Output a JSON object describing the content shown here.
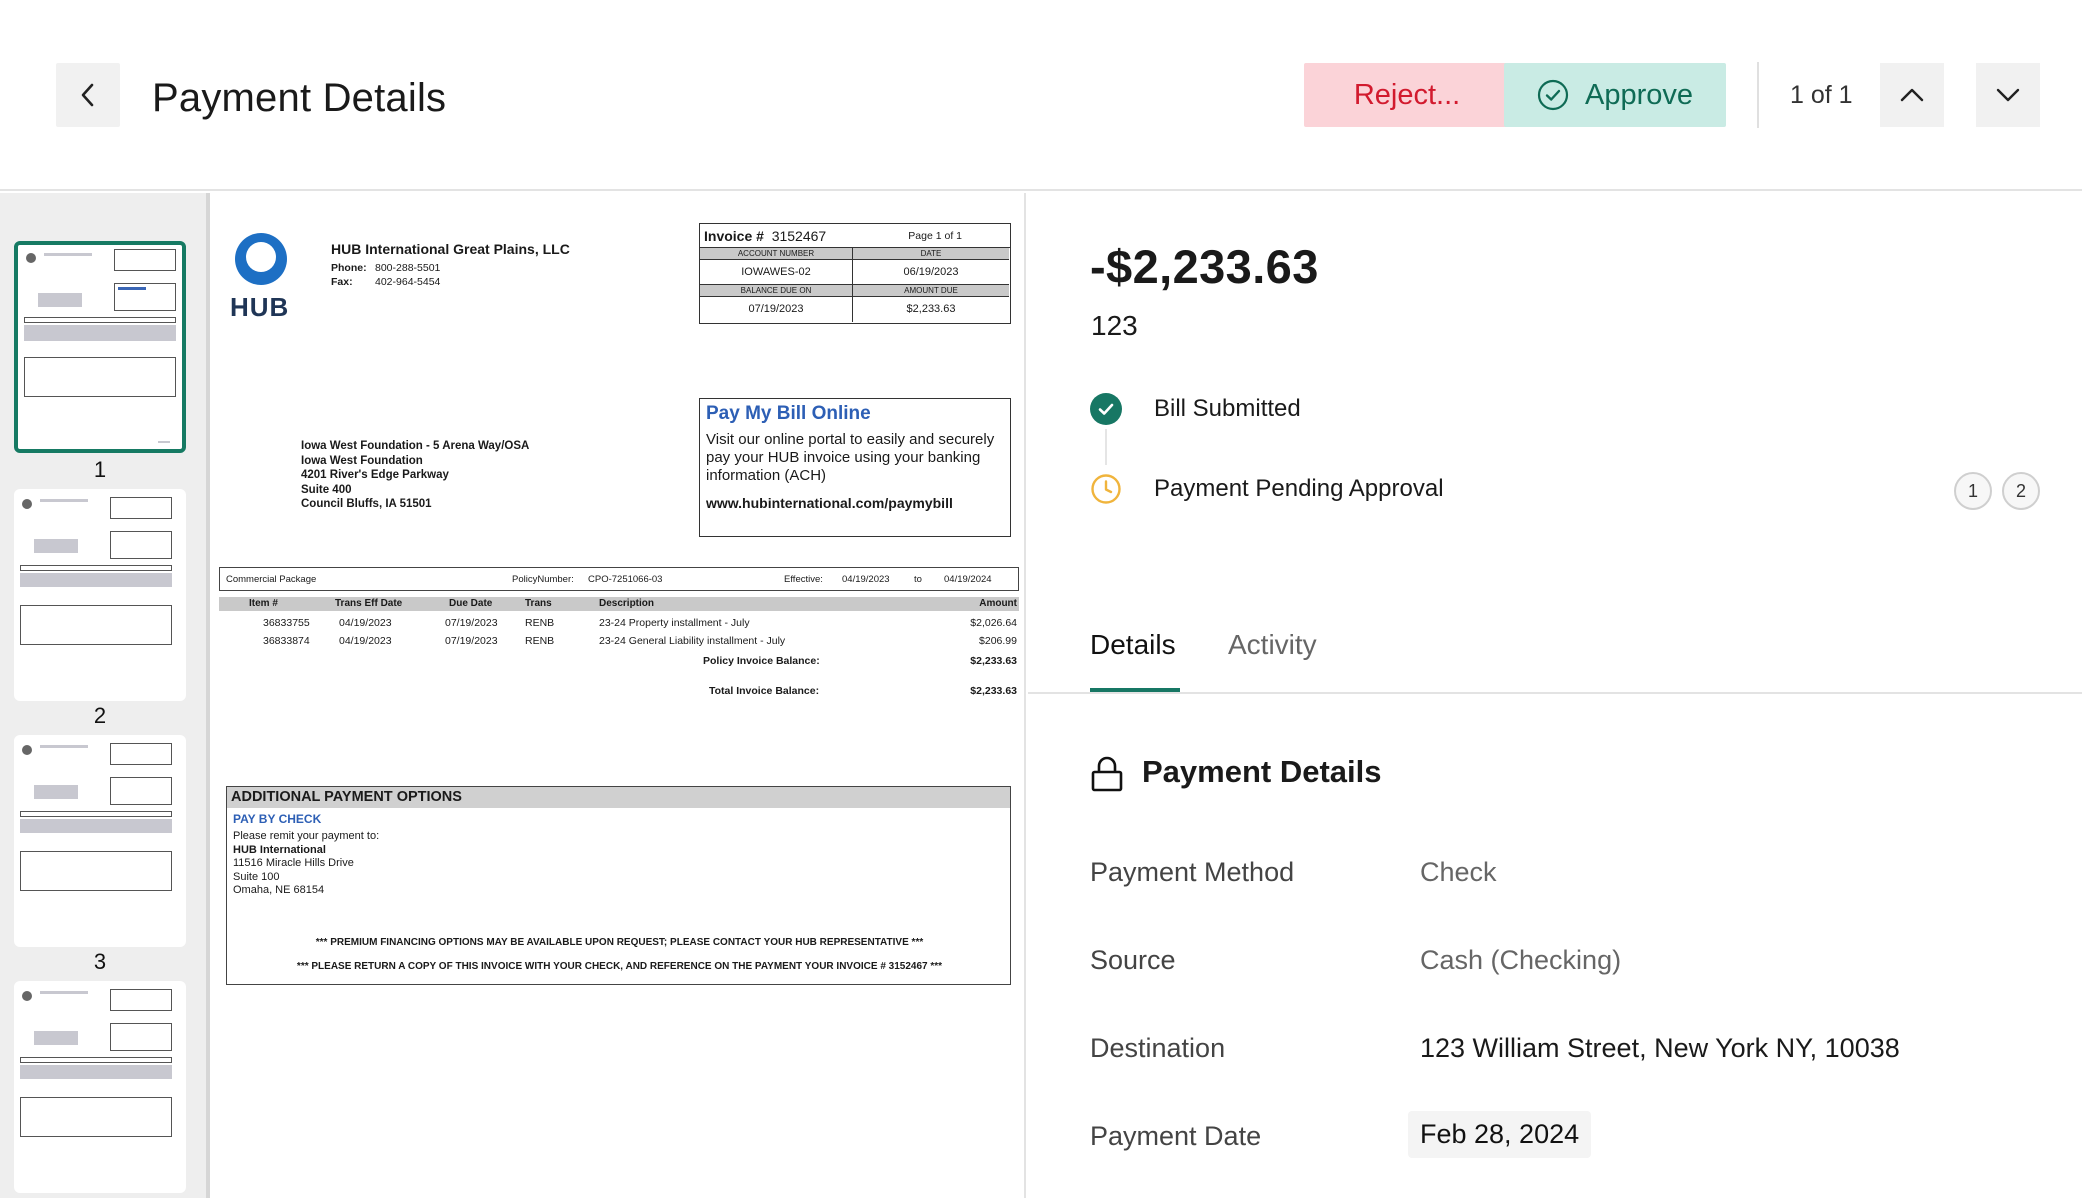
{
  "header": {
    "title": "Payment Details",
    "reject_label": "Reject...",
    "approve_label": "Approve",
    "pager": "1 of 1"
  },
  "thumbnails": [
    {
      "number": "1",
      "selected": true
    },
    {
      "number": "2",
      "selected": false
    },
    {
      "number": "3",
      "selected": false
    },
    {
      "number": "",
      "selected": false
    }
  ],
  "invoice": {
    "vendor": {
      "name": "HUB International Great Plains, LLC",
      "phone_label": "Phone:",
      "phone": "800-288-5501",
      "fax_label": "Fax:",
      "fax": "402-964-5454",
      "logo_text": "HUB"
    },
    "number_label": "Invoice #",
    "number": "3152467",
    "page": "Page  1 of 1",
    "account_number_label": "ACCOUNT NUMBER",
    "account_number": "IOWAWES-02",
    "date_label": "DATE",
    "date": "06/19/2023",
    "balance_due_on_label": "BALANCE DUE ON",
    "balance_due_on": "07/19/2023",
    "amount_due_label": "AMOUNT DUE",
    "amount_due": "$2,233.63",
    "bill_to": [
      "Iowa West Foundation - 5 Arena Way/OSA",
      "Iowa West Foundation",
      "4201 River's Edge Parkway",
      "Suite 400",
      "Council Bluffs, IA 51501"
    ],
    "pay_online": {
      "title": "Pay My Bill Online",
      "body": "Visit our online portal to easily and securely pay your HUB invoice using your banking information (ACH)",
      "url": "www.hubinternational.com/paymybill"
    },
    "policy": {
      "package": "Commercial Package",
      "policy_number_label": "PolicyNumber:",
      "policy_number": "CPO-7251066-03",
      "effective_label": "Effective:",
      "effective_from": "04/19/2023",
      "to_label": "to",
      "effective_to": "04/19/2024"
    },
    "columns": [
      "Item #",
      "Trans Eff Date",
      "Due Date",
      "Trans",
      "Description",
      "Amount"
    ],
    "items": [
      {
        "item": "36833755",
        "trans_eff": "04/19/2023",
        "due": "07/19/2023",
        "trans": "RENB",
        "desc": "23-24 Property installment - July",
        "amount": "$2,026.64"
      },
      {
        "item": "36833874",
        "trans_eff": "04/19/2023",
        "due": "07/19/2023",
        "trans": "RENB",
        "desc": "23-24 General Liability installment - July",
        "amount": "$206.99"
      }
    ],
    "policy_balance_label": "Policy Invoice Balance:",
    "policy_balance": "$2,233.63",
    "total_balance_label": "Total Invoice Balance:",
    "total_balance": "$2,233.63",
    "additional": {
      "heading": "ADDITIONAL PAYMENT OPTIONS",
      "pay_by_check": "PAY BY CHECK",
      "remit_intro": "Please remit your payment to:",
      "remit_name": "HUB International",
      "remit_lines": [
        "11516 Miracle Hills Drive",
        "Suite 100",
        "Omaha, NE 68154"
      ],
      "note1": "*** PREMIUM FINANCING OPTIONS MAY BE AVAILABLE UPON REQUEST; PLEASE CONTACT YOUR HUB REPRESENTATIVE ***",
      "note2": "*** PLEASE RETURN A COPY OF THIS INVOICE WITH YOUR CHECK, AND REFERENCE ON THE PAYMENT YOUR INVOICE #   3152467 ***"
    }
  },
  "panel": {
    "amount": "-$2,233.63",
    "reference": "123",
    "timeline": [
      {
        "label": "Bill Submitted",
        "status": "complete"
      },
      {
        "label": "Payment Pending Approval",
        "status": "pending"
      }
    ],
    "approvers": [
      "1",
      "2"
    ],
    "tabs": [
      {
        "label": "Details",
        "active": true
      },
      {
        "label": "Activity",
        "active": false
      }
    ],
    "section_title": "Payment Details",
    "fields": [
      {
        "label": "Payment Method",
        "value": "Check"
      },
      {
        "label": "Source",
        "value": "Cash (Checking)"
      },
      {
        "label": "Destination",
        "value": "123 William Street, New York NY, 10038"
      },
      {
        "label": "Payment Date",
        "value": "Feb 28, 2024"
      }
    ]
  },
  "colors": {
    "accent_green": "#177764",
    "reject_bg": "#fbd3d8",
    "reject_text": "#d21a2e",
    "approve_bg": "#c9ebe4",
    "approve_text": "#0f6b55",
    "pending_amber": "#f0b43c",
    "hub_blue": "#1d6fc4"
  },
  "icons": {
    "back": "chevron-left-icon",
    "approve": "check-circle-icon",
    "pager_up": "chevron-up-icon",
    "pager_down": "chevron-down-icon",
    "timeline_done": "check-circle-filled-icon",
    "timeline_pending": "clock-icon",
    "section": "lock-icon"
  }
}
